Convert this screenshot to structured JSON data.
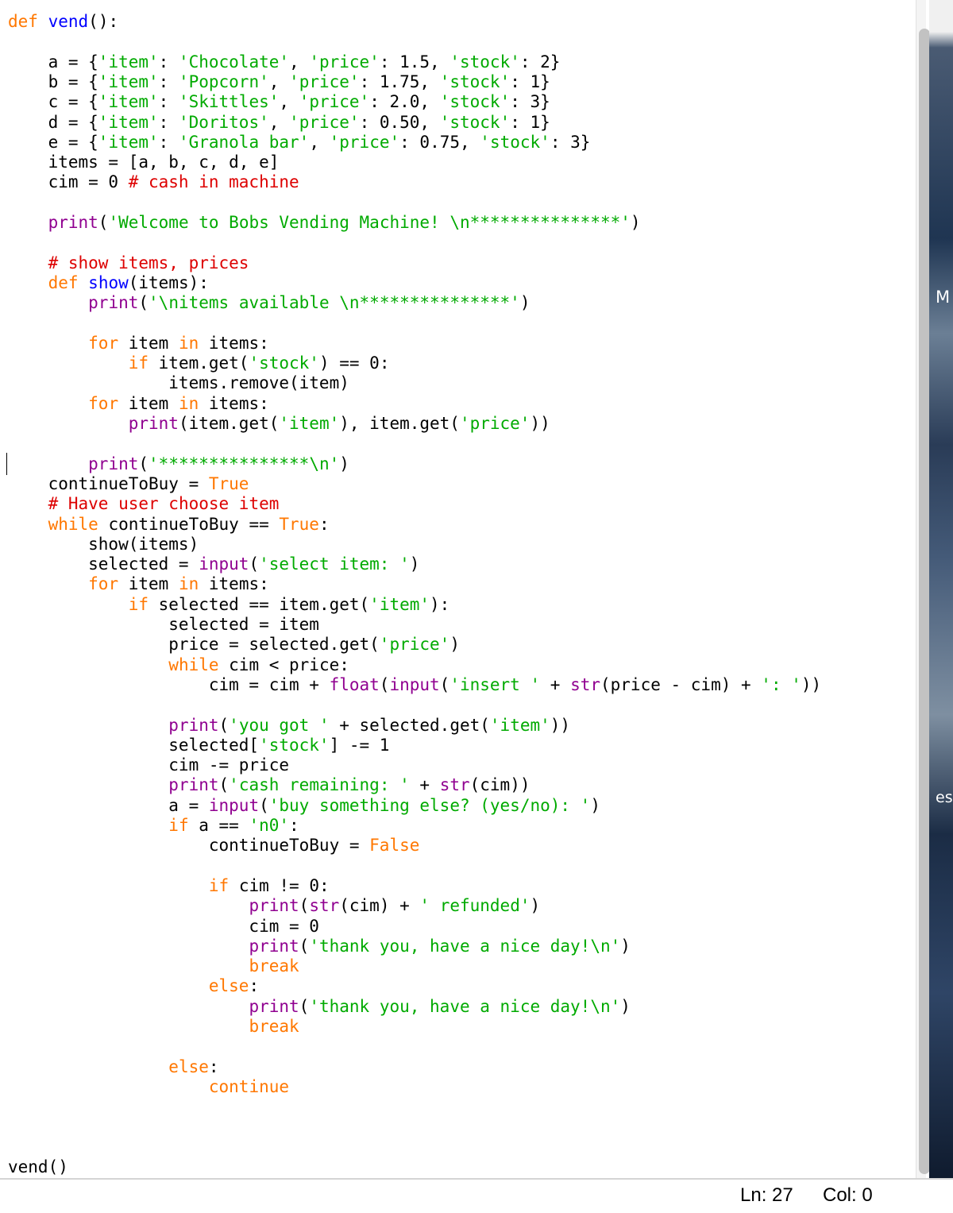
{
  "editor": {
    "lines": [
      [
        [
          "kw",
          "def"
        ],
        [
          "t",
          " "
        ],
        [
          "def",
          "vend"
        ],
        [
          "t",
          "():"
        ]
      ],
      [],
      [
        [
          "t",
          "    a = {"
        ],
        [
          "str",
          "'item'"
        ],
        [
          "t",
          ": "
        ],
        [
          "str",
          "'Chocolate'"
        ],
        [
          "t",
          ", "
        ],
        [
          "str",
          "'price'"
        ],
        [
          "t",
          ": 1.5, "
        ],
        [
          "str",
          "'stock'"
        ],
        [
          "t",
          ": 2}"
        ]
      ],
      [
        [
          "t",
          "    b = {"
        ],
        [
          "str",
          "'item'"
        ],
        [
          "t",
          ": "
        ],
        [
          "str",
          "'Popcorn'"
        ],
        [
          "t",
          ", "
        ],
        [
          "str",
          "'price'"
        ],
        [
          "t",
          ": 1.75, "
        ],
        [
          "str",
          "'stock'"
        ],
        [
          "t",
          ": 1}"
        ]
      ],
      [
        [
          "t",
          "    c = {"
        ],
        [
          "str",
          "'item'"
        ],
        [
          "t",
          ": "
        ],
        [
          "str",
          "'Skittles'"
        ],
        [
          "t",
          ", "
        ],
        [
          "str",
          "'price'"
        ],
        [
          "t",
          ": 2.0, "
        ],
        [
          "str",
          "'stock'"
        ],
        [
          "t",
          ": 3}"
        ]
      ],
      [
        [
          "t",
          "    d = {"
        ],
        [
          "str",
          "'item'"
        ],
        [
          "t",
          ": "
        ],
        [
          "str",
          "'Doritos'"
        ],
        [
          "t",
          ", "
        ],
        [
          "str",
          "'price'"
        ],
        [
          "t",
          ": 0.50, "
        ],
        [
          "str",
          "'stock'"
        ],
        [
          "t",
          ": 1}"
        ]
      ],
      [
        [
          "t",
          "    e = {"
        ],
        [
          "str",
          "'item'"
        ],
        [
          "t",
          ": "
        ],
        [
          "str",
          "'Granola bar'"
        ],
        [
          "t",
          ", "
        ],
        [
          "str",
          "'price'"
        ],
        [
          "t",
          ": 0.75, "
        ],
        [
          "str",
          "'stock'"
        ],
        [
          "t",
          ": 3}"
        ]
      ],
      [
        [
          "t",
          "    items = [a, b, c, d, e]"
        ]
      ],
      [
        [
          "t",
          "    cim = 0 "
        ],
        [
          "com",
          "# cash in machine"
        ]
      ],
      [],
      [
        [
          "t",
          "    "
        ],
        [
          "bi",
          "print"
        ],
        [
          "t",
          "("
        ],
        [
          "str",
          "'Welcome to Bobs Vending Machine! \\n***************'"
        ],
        [
          "t",
          ")"
        ]
      ],
      [],
      [
        [
          "t",
          "    "
        ],
        [
          "com",
          "# show items, prices"
        ]
      ],
      [
        [
          "t",
          "    "
        ],
        [
          "kw",
          "def"
        ],
        [
          "t",
          " "
        ],
        [
          "def",
          "show"
        ],
        [
          "t",
          "(items):"
        ]
      ],
      [
        [
          "t",
          "        "
        ],
        [
          "bi",
          "print"
        ],
        [
          "t",
          "("
        ],
        [
          "str",
          "'\\nitems available \\n***************'"
        ],
        [
          "t",
          ")"
        ]
      ],
      [],
      [
        [
          "t",
          "        "
        ],
        [
          "kw",
          "for"
        ],
        [
          "t",
          " item "
        ],
        [
          "kw",
          "in"
        ],
        [
          "t",
          " items:"
        ]
      ],
      [
        [
          "t",
          "            "
        ],
        [
          "kw",
          "if"
        ],
        [
          "t",
          " item.get("
        ],
        [
          "str",
          "'stock'"
        ],
        [
          "t",
          ") == 0:"
        ]
      ],
      [
        [
          "t",
          "                items.remove(item)"
        ]
      ],
      [
        [
          "t",
          "        "
        ],
        [
          "kw",
          "for"
        ],
        [
          "t",
          " item "
        ],
        [
          "kw",
          "in"
        ],
        [
          "t",
          " items:"
        ]
      ],
      [
        [
          "t",
          "            "
        ],
        [
          "bi",
          "print"
        ],
        [
          "t",
          "(item.get("
        ],
        [
          "str",
          "'item'"
        ],
        [
          "t",
          "), item.get("
        ],
        [
          "str",
          "'price'"
        ],
        [
          "t",
          "))"
        ]
      ],
      [],
      [
        [
          "t",
          "        "
        ],
        [
          "bi",
          "print"
        ],
        [
          "t",
          "("
        ],
        [
          "str",
          "'***************\\n'"
        ],
        [
          "t",
          ")"
        ]
      ],
      [
        [
          "t",
          "    continueToBuy = "
        ],
        [
          "kw",
          "True"
        ]
      ],
      [
        [
          "t",
          "    "
        ],
        [
          "com",
          "# Have user choose item"
        ]
      ],
      [
        [
          "t",
          "    "
        ],
        [
          "kw",
          "while"
        ],
        [
          "t",
          " continueToBuy == "
        ],
        [
          "kw",
          "True"
        ],
        [
          "t",
          ":"
        ]
      ],
      [
        [
          "t",
          "        show(items)"
        ]
      ],
      [
        [
          "t",
          "        selected = "
        ],
        [
          "bi",
          "input"
        ],
        [
          "t",
          "("
        ],
        [
          "str",
          "'select item: '"
        ],
        [
          "t",
          ")"
        ]
      ],
      [
        [
          "t",
          "        "
        ],
        [
          "kw",
          "for"
        ],
        [
          "t",
          " item "
        ],
        [
          "kw",
          "in"
        ],
        [
          "t",
          " items:"
        ]
      ],
      [
        [
          "t",
          "            "
        ],
        [
          "kw",
          "if"
        ],
        [
          "t",
          " selected == item.get("
        ],
        [
          "str",
          "'item'"
        ],
        [
          "t",
          "):"
        ]
      ],
      [
        [
          "t",
          "                selected = item"
        ]
      ],
      [
        [
          "t",
          "                price = selected.get("
        ],
        [
          "str",
          "'price'"
        ],
        [
          "t",
          ")"
        ]
      ],
      [
        [
          "t",
          "                "
        ],
        [
          "kw",
          "while"
        ],
        [
          "t",
          " cim < price:"
        ]
      ],
      [
        [
          "t",
          "                    cim = cim + "
        ],
        [
          "bi",
          "float"
        ],
        [
          "t",
          "("
        ],
        [
          "bi",
          "input"
        ],
        [
          "t",
          "("
        ],
        [
          "str",
          "'insert '"
        ],
        [
          "t",
          " + "
        ],
        [
          "bi",
          "str"
        ],
        [
          "t",
          "(price - cim) + "
        ],
        [
          "str",
          "': '"
        ],
        [
          "t",
          "))"
        ]
      ],
      [],
      [
        [
          "t",
          "                "
        ],
        [
          "bi",
          "print"
        ],
        [
          "t",
          "("
        ],
        [
          "str",
          "'you got '"
        ],
        [
          "t",
          " + selected.get("
        ],
        [
          "str",
          "'item'"
        ],
        [
          "t",
          "))"
        ]
      ],
      [
        [
          "t",
          "                selected["
        ],
        [
          "str",
          "'stock'"
        ],
        [
          "t",
          "] -= 1"
        ]
      ],
      [
        [
          "t",
          "                cim -= price"
        ]
      ],
      [
        [
          "t",
          "                "
        ],
        [
          "bi",
          "print"
        ],
        [
          "t",
          "("
        ],
        [
          "str",
          "'cash remaining: '"
        ],
        [
          "t",
          " + "
        ],
        [
          "bi",
          "str"
        ],
        [
          "t",
          "(cim))"
        ]
      ],
      [
        [
          "t",
          "                a = "
        ],
        [
          "bi",
          "input"
        ],
        [
          "t",
          "("
        ],
        [
          "str",
          "'buy something else? (yes/no): '"
        ],
        [
          "t",
          ")"
        ]
      ],
      [
        [
          "t",
          "                "
        ],
        [
          "kw",
          "if"
        ],
        [
          "t",
          " a == "
        ],
        [
          "str",
          "'n0'"
        ],
        [
          "t",
          ":"
        ]
      ],
      [
        [
          "t",
          "                    continueToBuy = "
        ],
        [
          "kw",
          "False"
        ]
      ],
      [],
      [
        [
          "t",
          "                    "
        ],
        [
          "kw",
          "if"
        ],
        [
          "t",
          " cim != 0:"
        ]
      ],
      [
        [
          "t",
          "                        "
        ],
        [
          "bi",
          "print"
        ],
        [
          "t",
          "("
        ],
        [
          "bi",
          "str"
        ],
        [
          "t",
          "(cim) + "
        ],
        [
          "str",
          "' refunded'"
        ],
        [
          "t",
          ")"
        ]
      ],
      [
        [
          "t",
          "                        cim = 0"
        ]
      ],
      [
        [
          "t",
          "                        "
        ],
        [
          "bi",
          "print"
        ],
        [
          "t",
          "("
        ],
        [
          "str",
          "'thank you, have a nice day!\\n'"
        ],
        [
          "t",
          ")"
        ]
      ],
      [
        [
          "t",
          "                        "
        ],
        [
          "kw",
          "break"
        ]
      ],
      [
        [
          "t",
          "                    "
        ],
        [
          "kw",
          "else"
        ],
        [
          "t",
          ":"
        ]
      ],
      [
        [
          "t",
          "                        "
        ],
        [
          "bi",
          "print"
        ],
        [
          "t",
          "("
        ],
        [
          "str",
          "'thank you, have a nice day!\\n'"
        ],
        [
          "t",
          ")"
        ]
      ],
      [
        [
          "t",
          "                        "
        ],
        [
          "kw",
          "break"
        ]
      ],
      [],
      [
        [
          "t",
          "                "
        ],
        [
          "kw",
          "else"
        ],
        [
          "t",
          ":"
        ]
      ],
      [
        [
          "t",
          "                    "
        ],
        [
          "kw",
          "continue"
        ]
      ],
      [],
      [],
      [],
      [
        [
          "t",
          "vend()"
        ]
      ]
    ],
    "colors": {
      "keyword": "#ff7700",
      "builtin": "#900090",
      "string": "#00aa00",
      "comment": "#dd0000",
      "definition": "#0000ff"
    }
  },
  "desktop": {
    "label_1": "M",
    "label_2": "es"
  },
  "statusbar": {
    "line": "Ln: 27",
    "col": "Col: 0"
  }
}
